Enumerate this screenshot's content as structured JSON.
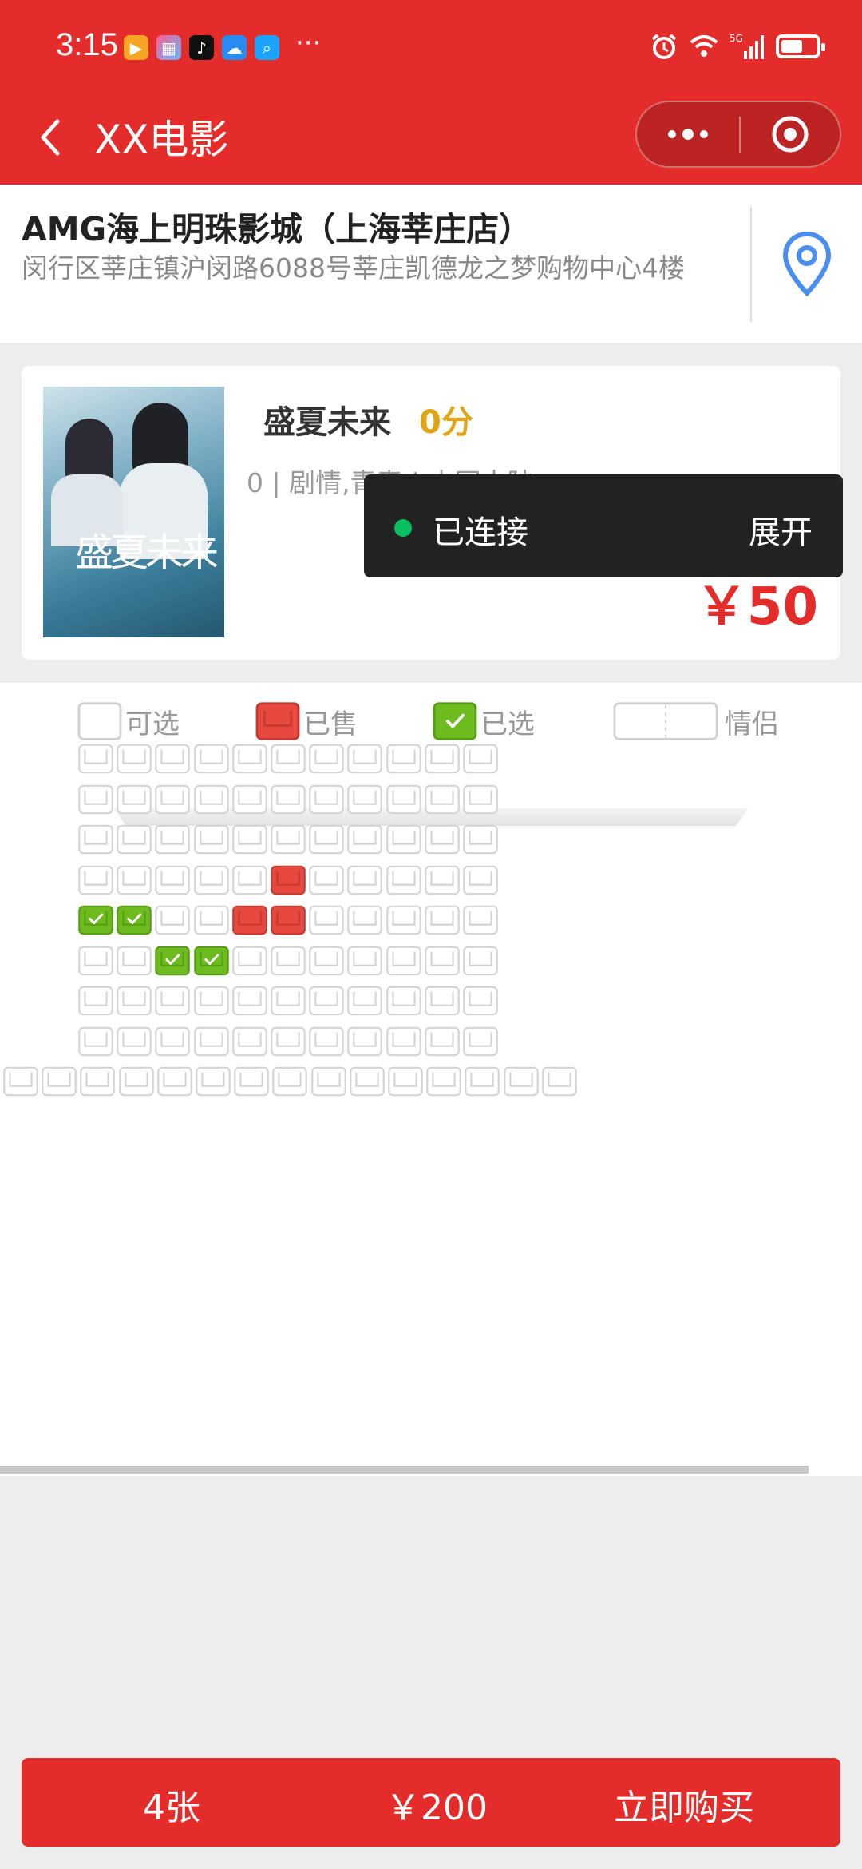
{
  "status_bar": {
    "time": "3:15",
    "more": "···",
    "network": "5G",
    "battery_level": 0.55
  },
  "nav": {
    "title": "XX电影"
  },
  "cinema": {
    "name": "AMG海上明珠影城（上海莘庄店）",
    "address": "闵行区莘庄镇沪闵路6088号莘庄凯德龙之梦购物中心4楼"
  },
  "movie": {
    "poster_title": "盛夏未来",
    "name": "盛夏未来",
    "score": "0分",
    "meta": "0 | 剧情,青春 | 中国大陆",
    "price": "￥50"
  },
  "toast": {
    "text": "已连接",
    "action": "展开"
  },
  "legend": {
    "available": "可选",
    "sold": "已售",
    "selected": "已选",
    "couple": "情侣"
  },
  "colors": {
    "brand_red": "#e42d2b",
    "sold": "#e8493f",
    "selected": "#6dbb1f",
    "score": "#e0a415",
    "connected_dot": "#07c160"
  },
  "seat_map": {
    "rows": [
      "AAAAAAAAAAA",
      "AAAAAAAAAAA",
      "AAAAAAAAAAA",
      "AAAAASAAAAA",
      "CCAASSAAAAA",
      "AACCAAAAAAA",
      "AAAAAAAAAAA",
      "AAAAAAAAAAA",
      "AAAAAAAAAAAAAAA"
    ]
  },
  "bottom_bar": {
    "count": "4张",
    "total": "￥200",
    "buy_label": "立即购买"
  }
}
